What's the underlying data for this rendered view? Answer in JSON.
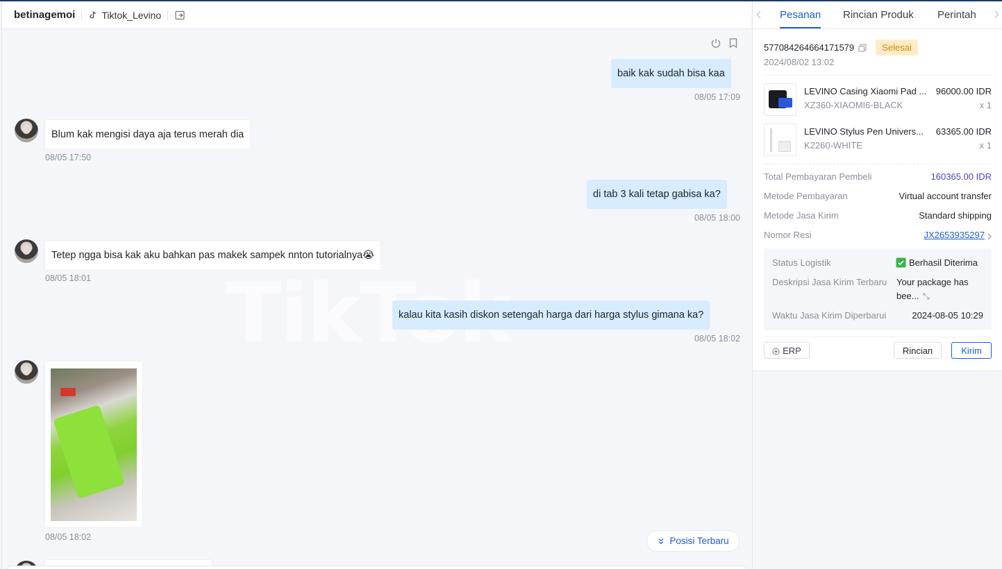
{
  "header": {
    "buyer_name": "betinagemoi",
    "shop_name": "Tiktok_Levino",
    "icons": [
      "tiktok-icon",
      "share-icon"
    ]
  },
  "toolbar": {
    "icons": [
      "power-icon",
      "bookmark-icon"
    ]
  },
  "watermark": "TikTok",
  "messages": [
    {
      "direction": "out",
      "text": "baik kak sudah bisa kaa",
      "time": "08/05 17:09"
    },
    {
      "direction": "in",
      "text": "Blum kak mengisi daya aja terus merah dia",
      "time": "08/05 17:50"
    },
    {
      "direction": "out",
      "text": "di tab 3 kali tetap gabisa ka?",
      "time": "08/05 18:00"
    },
    {
      "direction": "in",
      "text": "Tetep ngga bisa kak aku bahkan pas makek sampek nnton tutorialnya😭",
      "time": "08/05 18:01"
    },
    {
      "direction": "out",
      "text": "kalau kita kasih diskon setengah harga dari harga stylus gimana ka?",
      "time": "08/05 18:02"
    },
    {
      "direction": "in",
      "type": "image",
      "time": "08/05 18:02"
    }
  ],
  "latest_position_label": "Posisi Terbaru",
  "order_panel": {
    "tabs": [
      {
        "label": "Pesanan",
        "active": true
      },
      {
        "label": "Rincian Produk",
        "active": false
      },
      {
        "label": "Perintah",
        "active": false
      }
    ],
    "order_id": "577084264664171579",
    "status": "Selesai",
    "order_date": "2024/08/02 13:02",
    "products": [
      {
        "name": "LEVINO Casing Xiaomi Pad ...",
        "sku": "XZ360-XIAOMI6-BLACK",
        "price": "96000.00 IDR",
        "qty": "x 1"
      },
      {
        "name": "LEVINO Stylus Pen Univers...",
        "sku": "K2260-WHITE",
        "price": "63365.00 IDR",
        "qty": "x 1"
      }
    ],
    "summary": {
      "total_label": "Total Pembayaran Pembeli",
      "total_value": "160365.00 IDR",
      "payment_label": "Metode Pembayaran",
      "payment_value": "Virtual account transfer",
      "shipping_label": "Metode Jasa Kirim",
      "shipping_value": "Standard shipping",
      "tracking_label": "Nomor Resi",
      "tracking_value": "JX2653935297"
    },
    "logistics": {
      "status_label": "Status Logistik",
      "status_value": "Berhasil Diterima",
      "desc_label": "Deskripsi Jasa Kirim Terbaru",
      "desc_value_line1": "Your package has",
      "desc_value_line2": "bee...",
      "updated_label": "Waktu Jasa Kirim Diperbarui",
      "updated_value": "2024-08-05 10:29"
    },
    "buttons": {
      "erp": "ERP",
      "detail": "Rincian",
      "send": "Kirim"
    }
  },
  "colors": {
    "accent": "#1d5bd6",
    "outgoing_bubble": "#d7ecfe",
    "status_badge_bg": "#fdecc8",
    "status_badge_text": "#d3870a",
    "total": "#4a45b8"
  }
}
